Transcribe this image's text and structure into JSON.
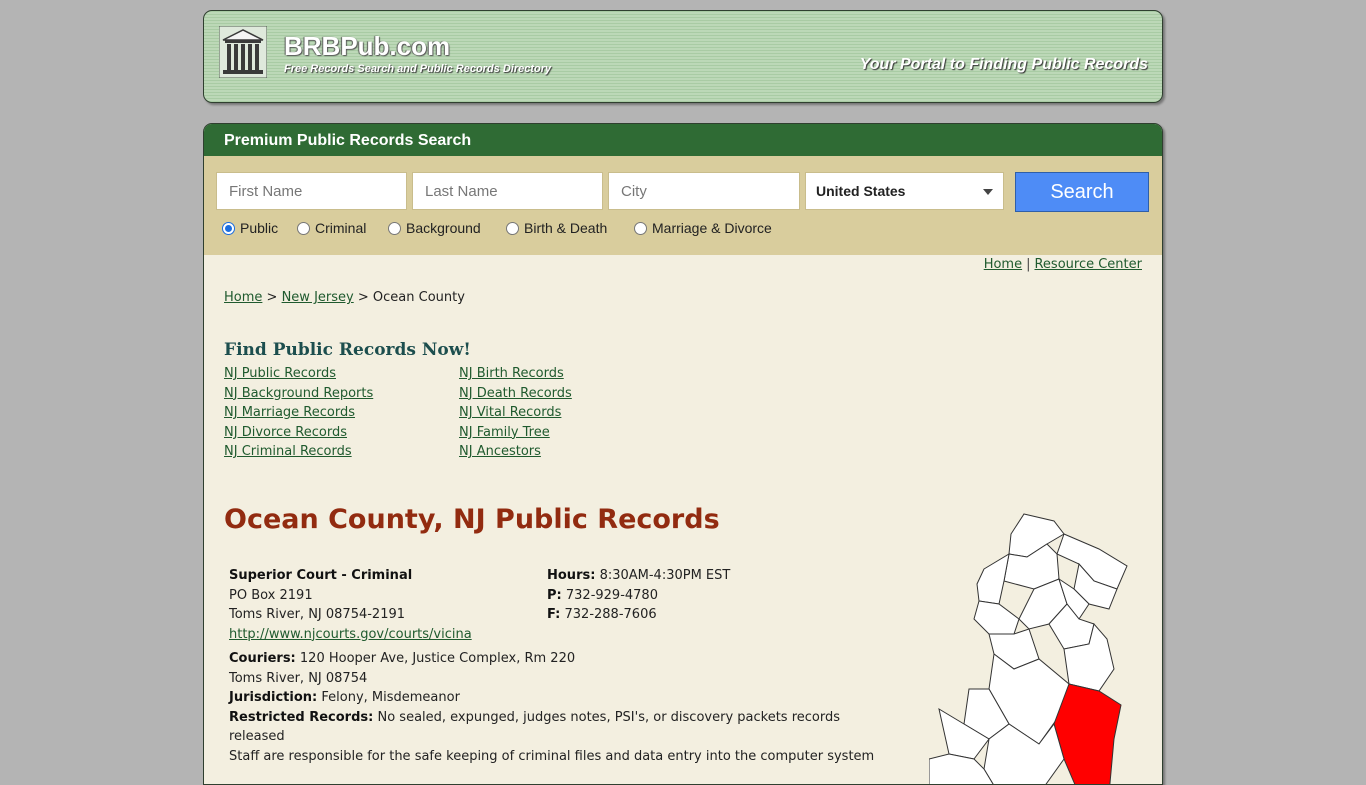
{
  "header": {
    "brand_name": "BRBPub.com",
    "brand_tagline": "Free Records Search and Public Records Directory",
    "portal_text": "Your Portal to Finding Public Records"
  },
  "search": {
    "title": "Premium Public Records Search",
    "first_name_placeholder": "First Name",
    "last_name_placeholder": "Last Name",
    "city_placeholder": "City",
    "country_selected": "United States",
    "button_label": "Search",
    "record_types": [
      {
        "label": "Public",
        "checked": true
      },
      {
        "label": "Criminal",
        "checked": false
      },
      {
        "label": "Background",
        "checked": false
      },
      {
        "label": "Birth & Death",
        "checked": false
      },
      {
        "label": "Marriage & Divorce",
        "checked": false
      }
    ]
  },
  "toplinks": {
    "home": "Home",
    "separator": "|",
    "resource_center": "Resource Center"
  },
  "breadcrumb": {
    "home": "Home",
    "sep": ">",
    "state": "New Jersey",
    "current": "Ocean County"
  },
  "find": {
    "heading": "Find Public Records Now!",
    "left_links": [
      "NJ Public Records",
      "NJ Background Reports",
      "NJ Marriage Records",
      "NJ Divorce Records",
      "NJ Criminal Records"
    ],
    "right_links": [
      "NJ Birth Records",
      "NJ Death Records",
      "NJ Vital Records",
      "NJ Family Tree",
      "NJ Ancestors"
    ]
  },
  "page_title": "Ocean County, NJ Public Records",
  "court": {
    "name": "Superior Court - Criminal",
    "address1": "PO Box 2191",
    "address2": "Toms River, NJ 08754-2191",
    "url": "http://www.njcourts.gov/courts/vicina",
    "hours_label": "Hours:",
    "hours": "8:30AM-4:30PM EST",
    "phone_label": "P:",
    "phone": "732-929-4780",
    "fax_label": "F:",
    "fax": "732-288-7606",
    "couriers_label": "Couriers:",
    "couriers": "120 Hooper Ave, Justice Complex, Rm 220",
    "couriers_city": "Toms River, NJ 08754",
    "jurisdiction_label": "Jurisdiction:",
    "jurisdiction": "Felony, Misdemeanor",
    "restricted_label": "Restricted Records:",
    "restricted": "No sealed, expunged, judges notes, PSI's, or discovery packets records released",
    "staff_note": "Staff are responsible for the safe keeping of criminal files and data entry into the computer system"
  },
  "colors": {
    "header_green": "#2f6b34",
    "search_tan": "#d9cd9d",
    "title_red": "#922b10",
    "highlight_red": "#ff0000"
  }
}
